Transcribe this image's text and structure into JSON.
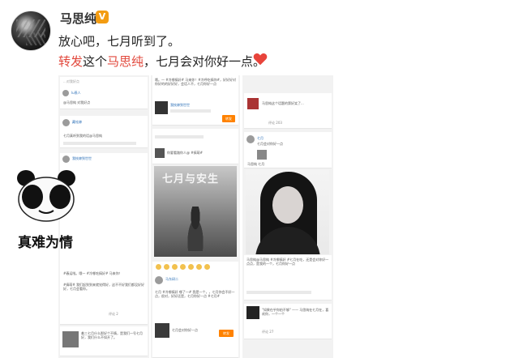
{
  "post": {
    "author": "马思纯",
    "verified_badge": "V",
    "line1": "放心吧，七月听到了。",
    "line2_prefix": "转发",
    "line2_mid1": "这个",
    "line2_name": "马思纯",
    "line2_suffix": "，七月会对你好一点。",
    "heart_icon": "heart-icon"
  },
  "colors": {
    "accent_red": "#e2483c",
    "link_blue": "#2b6fb7",
    "badge_orange": "#f39c12",
    "heart": "#e8443b"
  },
  "col1": {
    "snippet_top": "...对我好点",
    "reply1_user": "lu羡人",
    "reply1_text": "@马思纯 对我好点",
    "reply2_user": "藏哇嫁",
    "reply2_text": "七月真听到我的话@马思纯",
    "reply3_user": "我枝嫁到世世",
    "meme_caption": "真难为情",
    "body_a": "#春运啦。哦一 #冷哪吃搞好# 马来你！",
    "body_b": "#搞萌# 我们起到到来就觉得好，这不不好我们都没好好好，七月会看你。",
    "reply_note": "着三七月什么那好个不情，是我们一号七月好，我们什么不如开了。",
    "count": "评论 2"
  },
  "col2": {
    "top_text": "哦。一 #冷哪搞好# 马来你！#冷呼吃搞你#，好好好对你好的的好好好，会话人不，七月你好一点",
    "share_btn": "转发",
    "mini_text": "你要看路你人@ #搞萌#",
    "photo_title": "七月与安生",
    "reply_user": "马东研二",
    "reply_text": "七月 #冷哪搞好 哪了一# 我是一个，，七月你会不好一点，很对，好好还是，七月你好一点 #七月#",
    "footer": "七月会对你好一点"
  },
  "col3": {
    "top_user": "马思纯",
    "top_text": "马思纯这个话题的第好笑了...",
    "count_a": "评论 203",
    "reply_user": "七月",
    "reply_text": "七月会对你好一点",
    "caption": "马思纯 七月",
    "body": "马思纯@马思纯 #冷哪搞好 #七月在吃，还是会对你好一点点，是我的一个，七月你好一点",
    "bottom_text": "\"如果在乎你拍不够\" —— 马思纯在七月在，喜欢你，一个一个",
    "count_b": "评论 27"
  }
}
